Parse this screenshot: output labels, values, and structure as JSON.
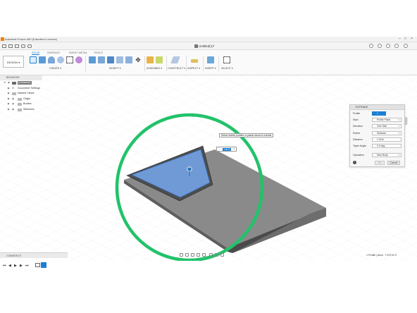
{
  "window": {
    "title": "Autodesk Fusion 360 (Education License)",
    "document_title": "Untitled(1)*"
  },
  "toolbar": {
    "workspace": "DESIGN ▾",
    "tabs": [
      "SOLID",
      "SURFACE",
      "SHEET METAL",
      "TOOLS"
    ],
    "groups": [
      "CREATE ▾",
      "MODIFY ▾",
      "ASSEMBLE ▾",
      "CONSTRUCT ▾",
      "INSPECT ▾",
      "INSERT ▾",
      "SELECT ▾"
    ]
  },
  "browser": {
    "header": "BROWSER",
    "items": [
      {
        "label": "(Unsaved)"
      },
      {
        "label": "Document Settings"
      },
      {
        "label": "Named Views"
      },
      {
        "label": "Origin"
      },
      {
        "label": "Bodies"
      },
      {
        "label": "Sketches"
      }
    ]
  },
  "canvas": {
    "tooltip": "Select sketch profiles or planar faces to extrude",
    "distance_value": "1.00 in"
  },
  "extrude": {
    "header": "EXTRUDE",
    "rows": [
      {
        "label": "Profile",
        "value": "1 selected"
      },
      {
        "label": "Start",
        "value": "Profile Plane"
      },
      {
        "label": "Direction",
        "value": "One Side"
      },
      {
        "label": "Extent",
        "value": "Distance"
      },
      {
        "label": "Distance",
        "value": "1.00 in"
      },
      {
        "label": "Taper Angle",
        "value": "0.0 deg"
      },
      {
        "label": "Operation",
        "value": "New Body"
      }
    ],
    "ok_label": "OK",
    "cancel_label": "Cancel"
  },
  "bottom": {
    "comments_label": "COMMENTS",
    "status": "1 Profile | Area : 7.672 in^2"
  },
  "colors": {
    "accent": "#1a7fd4",
    "highlight_circle": "#22c26a",
    "profile_fill": "#6f9ad6",
    "body": "#6a6a6a"
  }
}
